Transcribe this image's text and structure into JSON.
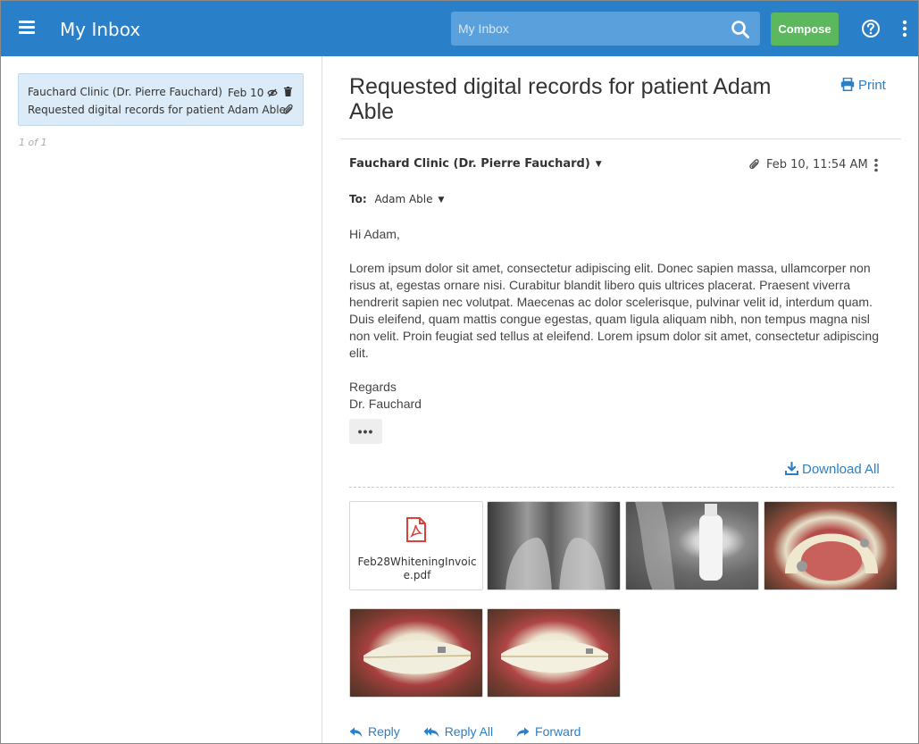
{
  "header": {
    "title": "My Inbox",
    "search_placeholder": "My Inbox",
    "compose_label": "Compose",
    "accent_color": "#2a80c8",
    "compose_color": "#5cb85c"
  },
  "message_list": {
    "items": [
      {
        "from": "Fauchard Clinic (Dr. Pierre Fauchard)",
        "date": "Feb 10",
        "subject": "Requested digital records for patient Adam Able"
      }
    ],
    "pager": "1 of 1"
  },
  "message": {
    "subject": "Requested digital records for patient Adam Able",
    "print_label": "Print",
    "sender": "Fauchard Clinic (Dr. Pierre Fauchard)",
    "datetime": "Feb 10, 11:54 AM",
    "to_label": "To:",
    "to_name": "Adam Able",
    "greeting": "Hi Adam,",
    "body": "Lorem ipsum dolor sit amet, consectetur adipiscing elit. Donec sapien massa, ullamcorper non risus at, egestas ornare nisi. Curabitur blandit libero quis ultrices placerat. Praesent viverra hendrerit sapien nec volutpat. Maecenas ac dolor scelerisque, pulvinar velit id, interdum quam. Duis eleifend, quam mattis congue egestas, quam ligula aliquam nibh, non tempus magna nisl non velit. Proin feugiat sed tellus at eleifend. Lorem ipsum dolor sit amet, consectetur adipiscing elit.",
    "signoff": "Regards",
    "signature": "Dr. Fauchard",
    "more_label": "•••",
    "download_all_label": "Download All",
    "attachments": [
      {
        "type": "pdf",
        "name": "Feb28WhiteningInvoice.pdf"
      },
      {
        "type": "image",
        "subject": "dental x-ray of front teeth"
      },
      {
        "type": "image",
        "subject": "dental x-ray of implant"
      },
      {
        "type": "image",
        "subject": "upper arch intraoral photo"
      },
      {
        "type": "image",
        "subject": "smile side view photo"
      },
      {
        "type": "image",
        "subject": "smile front view photo"
      }
    ]
  },
  "actions": {
    "reply": "Reply",
    "reply_all": "Reply All",
    "forward": "Forward"
  }
}
